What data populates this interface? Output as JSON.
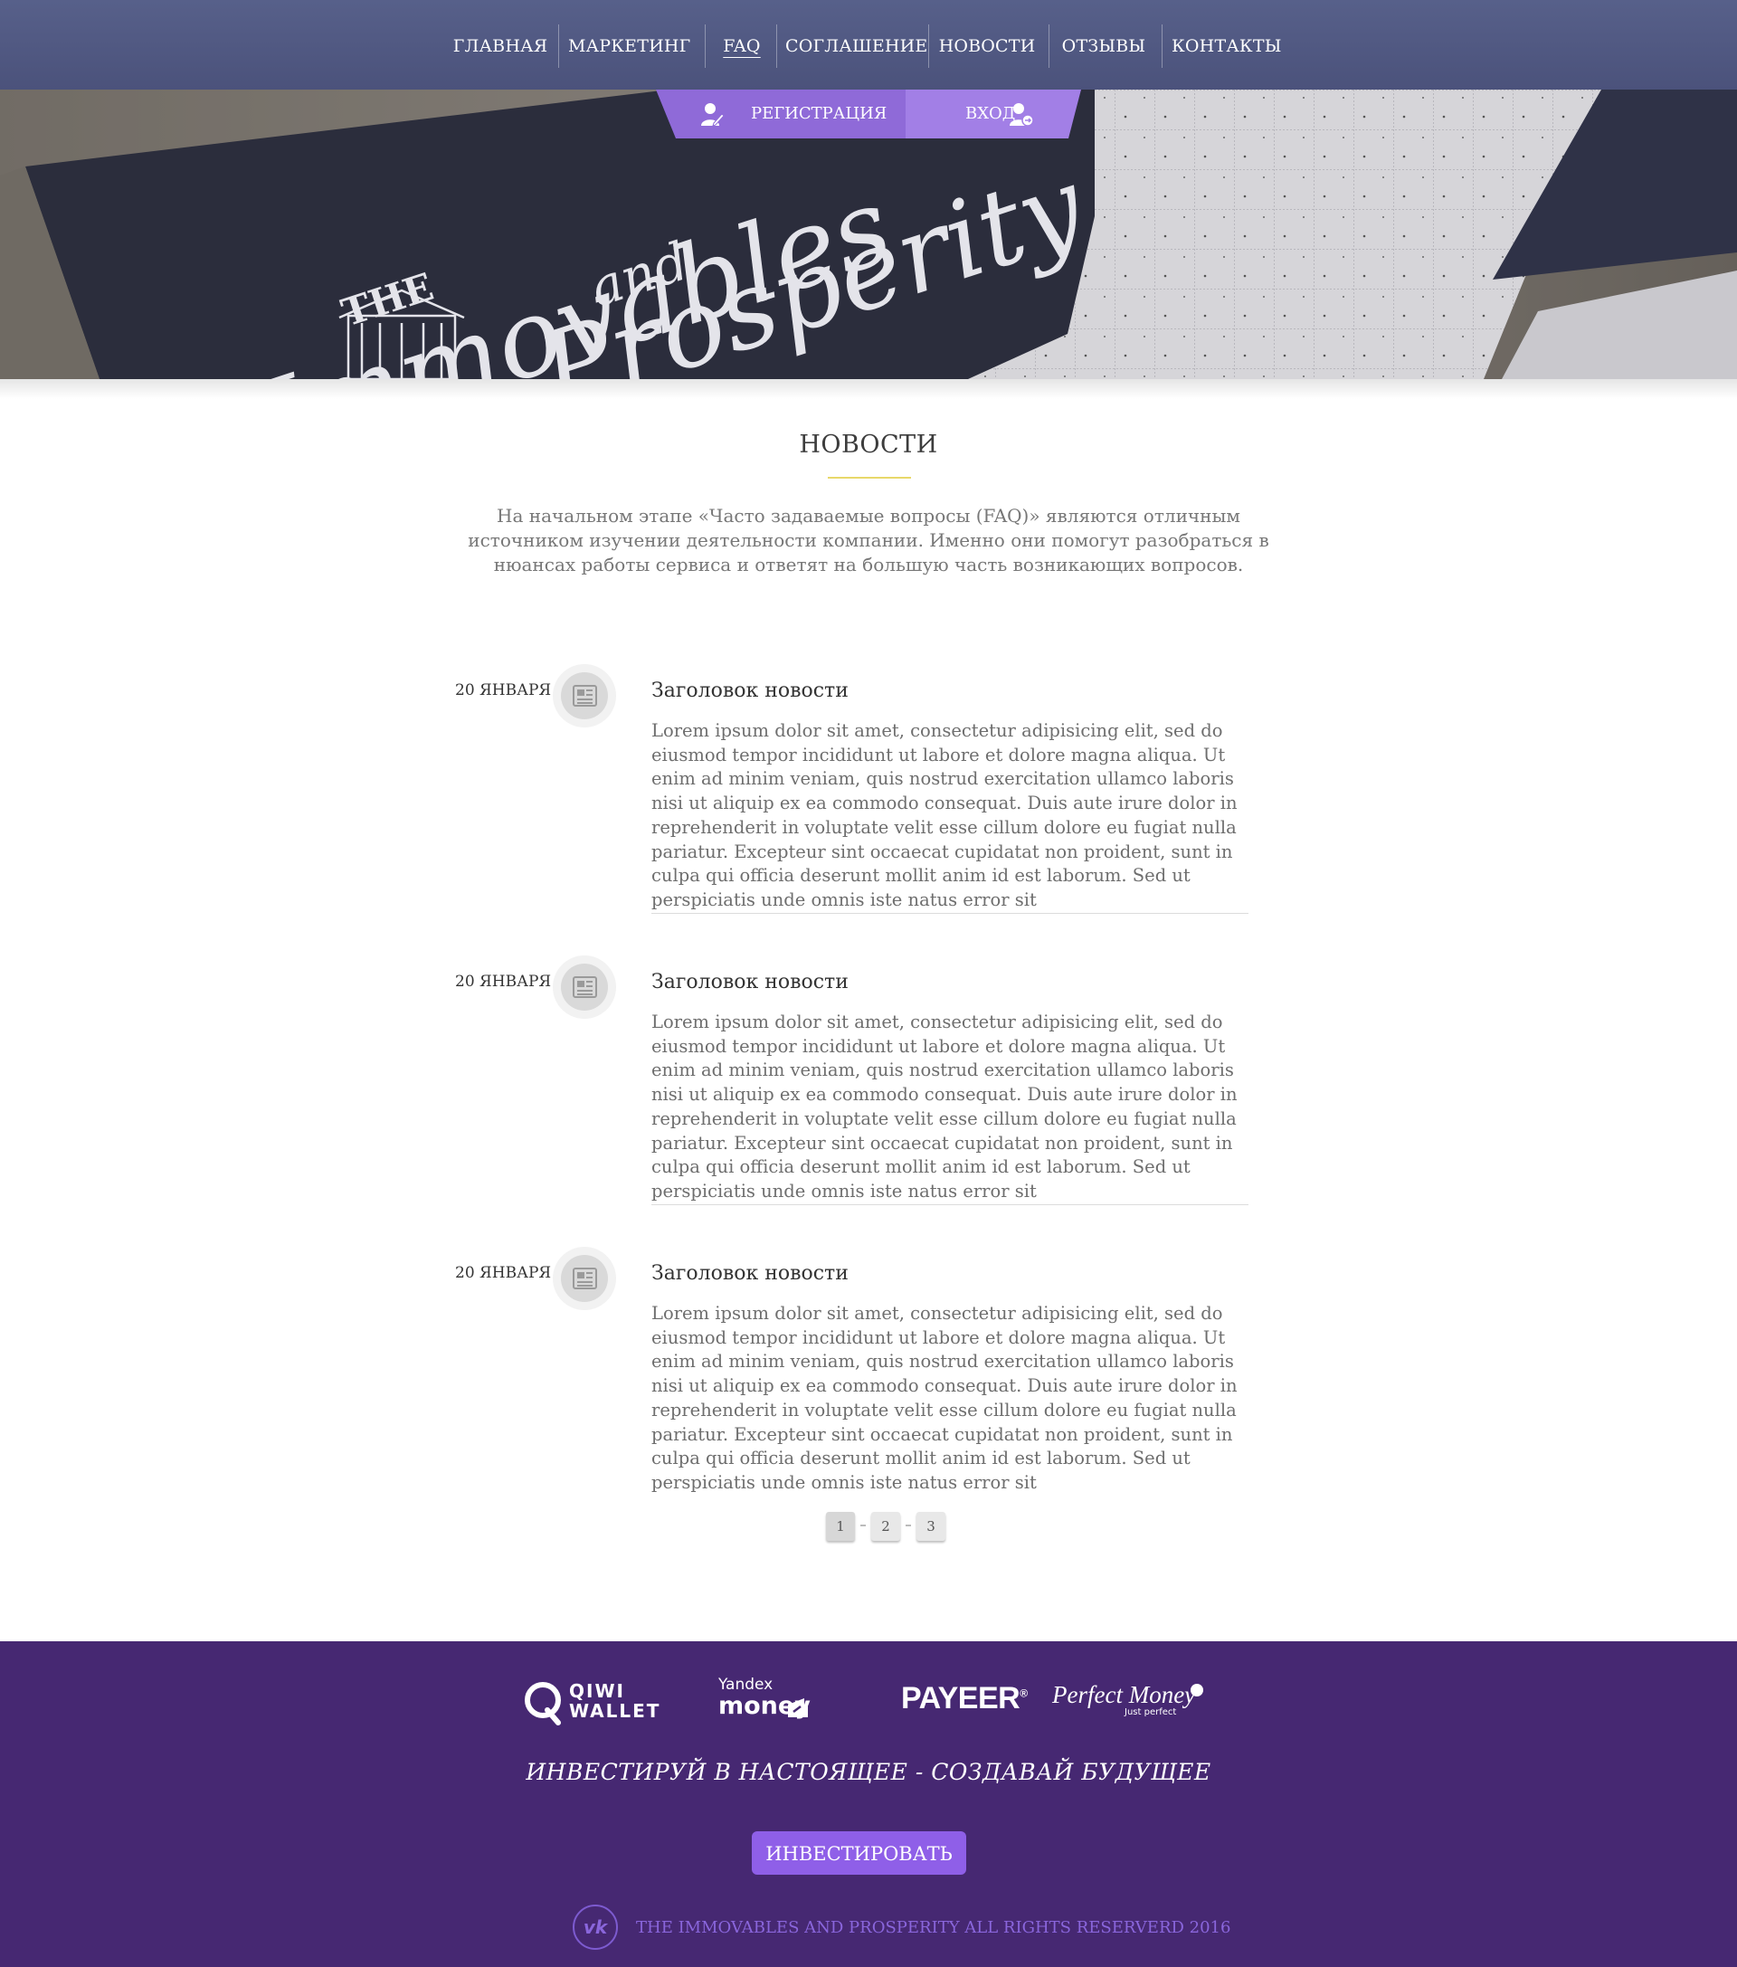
{
  "nav": {
    "items": [
      {
        "label": "ГЛАВНАЯ"
      },
      {
        "label": "МАРКЕТИНГ"
      },
      {
        "label": "FAQ",
        "active": true
      },
      {
        "label": "СОГЛАШЕНИЕ"
      },
      {
        "label": "НОВОСТИ"
      },
      {
        "label": "ОТЗЫВЫ"
      },
      {
        "label": "КОНТАКТЫ"
      }
    ]
  },
  "auth": {
    "register_label": "РЕГИСТРАЦИЯ",
    "login_label": "ВХОД"
  },
  "hero": {
    "logo_the": "THE",
    "logo_immovables": "Immovables",
    "logo_and": "and",
    "logo_prosperity": "Prosperity"
  },
  "main": {
    "title": "НОВОСТИ",
    "intro": "На начальном этапе «Часто задаваемые вопросы (FAQ)» являются отличным источником изучении деятельности компании. Именно они помогут разобраться в нюансах работы сервиса и ответят на большую часть возникающих вопросов.",
    "news": [
      {
        "date": "20 ЯНВАРЯ",
        "title": "Заголовок новости",
        "body": "Lorem ipsum dolor sit amet, consectetur adipisicing elit, sed do eiusmod tempor incididunt ut labore et dolore magna aliqua. Ut enim ad minim veniam, quis nostrud exercitation ullamco laboris nisi ut aliquip ex ea commodo consequat. Duis aute irure dolor in reprehenderit in voluptate velit esse cillum dolore eu fugiat nulla pariatur. Excepteur sint occaecat cupidatat non proident, sunt in culpa qui officia deserunt mollit anim id est laborum. Sed ut perspiciatis unde omnis iste natus error sit"
      },
      {
        "date": "20 ЯНВАРЯ",
        "title": "Заголовок новости",
        "body": "Lorem ipsum dolor sit amet, consectetur adipisicing elit, sed do eiusmod tempor incididunt ut labore et dolore magna aliqua. Ut enim ad minim veniam, quis nostrud exercitation ullamco laboris nisi ut aliquip ex ea commodo consequat. Duis aute irure dolor in reprehenderit in voluptate velit esse cillum dolore eu fugiat nulla pariatur. Excepteur sint occaecat cupidatat non proident, sunt in culpa qui officia deserunt mollit anim id est laborum. Sed ut perspiciatis unde omnis iste natus error sit"
      },
      {
        "date": "20 ЯНВАРЯ",
        "title": "Заголовок новости",
        "body": "Lorem ipsum dolor sit amet, consectetur adipisicing elit, sed do eiusmod tempor incididunt ut labore et dolore magna aliqua. Ut enim ad minim veniam, quis nostrud exercitation ullamco laboris nisi ut aliquip ex ea commodo consequat. Duis aute irure dolor in reprehenderit in voluptate velit esse cillum dolore eu fugiat nulla pariatur. Excepteur sint occaecat cupidatat non proident, sunt in culpa qui officia deserunt mollit anim id est laborum. Sed ut perspiciatis unde omnis iste natus error sit"
      }
    ],
    "pagination": {
      "pages": [
        "1",
        "2",
        "3"
      ],
      "current": "1"
    }
  },
  "footer": {
    "payments": {
      "qiwi_line1": "QIWI",
      "qiwi_line2": "WALLET",
      "yandex_line1": "Yandex",
      "yandex_line2": "money",
      "payeer": "PAYEER",
      "payeer_mark": "®",
      "perfect": "Perfect Money",
      "perfect_sub": "Just perfect"
    },
    "slogan": "ИНВЕСТИРУЙ В НАСТОЯЩЕЕ - СОЗДАВАЙ БУДУЩЕЕ",
    "invest_label": "ИНВЕСТИРОВАТЬ",
    "copyright": "THE IMMOVABLES AND PROSPERITY ALL RIGHTS RESERVERD 2016"
  },
  "colors": {
    "nav_bg": "#505880",
    "accent_purple": "#8f5fe8",
    "footer_bg": "#462872",
    "title_underline": "#e8d86a"
  }
}
